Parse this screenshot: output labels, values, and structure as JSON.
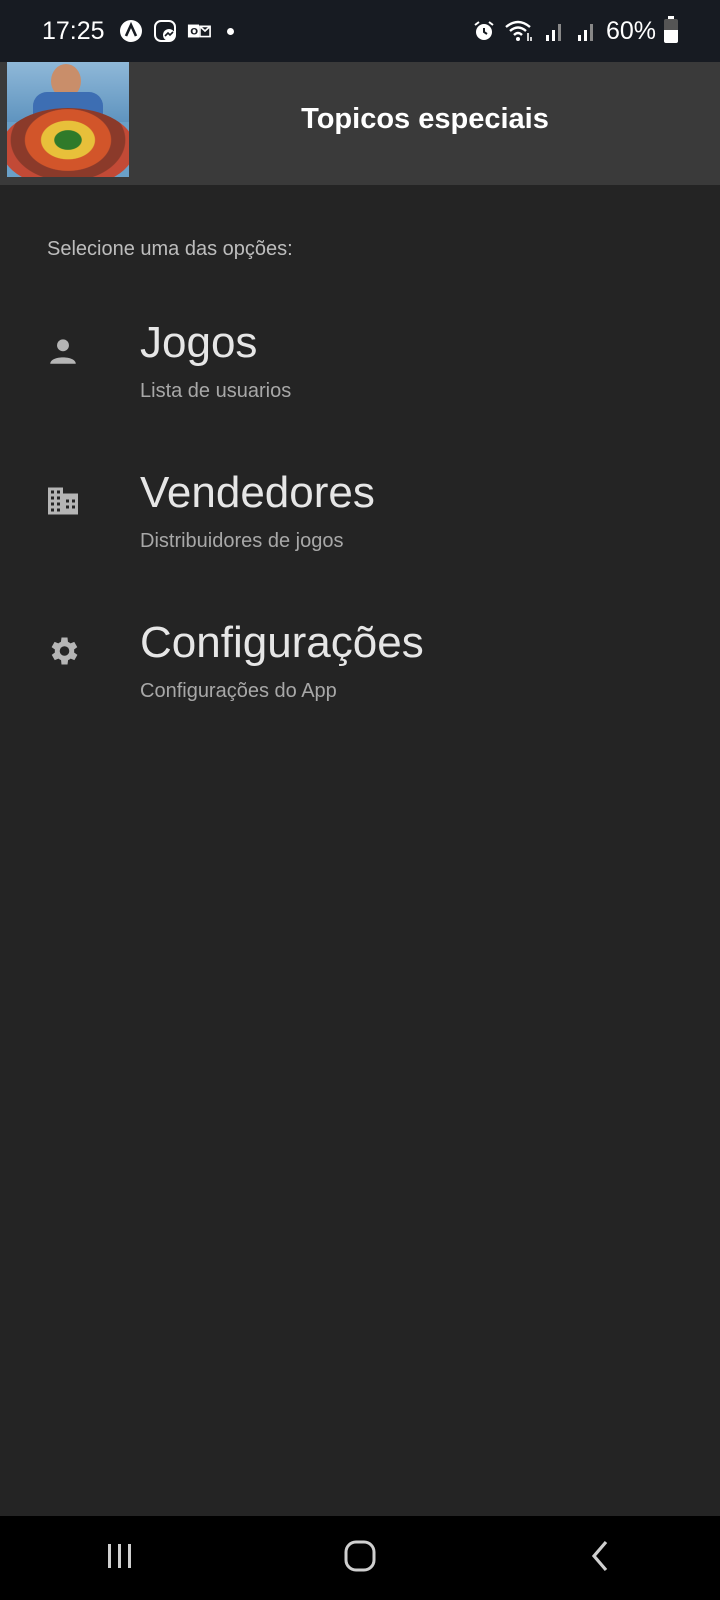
{
  "status_bar": {
    "time": "17:25",
    "battery_percent": "60%",
    "icons": [
      "app-a-icon",
      "messenger-icon",
      "outlook-icon",
      "notification-dot",
      "alarm-icon",
      "wifi-icon",
      "signal-icon",
      "signal-icon",
      "battery-icon"
    ]
  },
  "app_bar": {
    "title": "Topicos especiais",
    "avatar": "avatar-photo"
  },
  "content": {
    "prompt": "Selecione uma das opções:",
    "items": [
      {
        "title": "Jogos",
        "subtitle": "Lista de usuarios",
        "icon": "person-icon"
      },
      {
        "title": "Vendedores",
        "subtitle": "Distribuidores de jogos",
        "icon": "building-icon"
      },
      {
        "title": "Configurações",
        "subtitle": "Configurações do App",
        "icon": "gear-icon"
      }
    ]
  },
  "nav_bar": {
    "buttons": [
      "recents-icon",
      "home-icon",
      "back-icon"
    ]
  },
  "colors": {
    "background": "#242424",
    "app_bar": "#3a3a3a",
    "status_bar": "#171b22",
    "nav_bar": "#000000"
  }
}
